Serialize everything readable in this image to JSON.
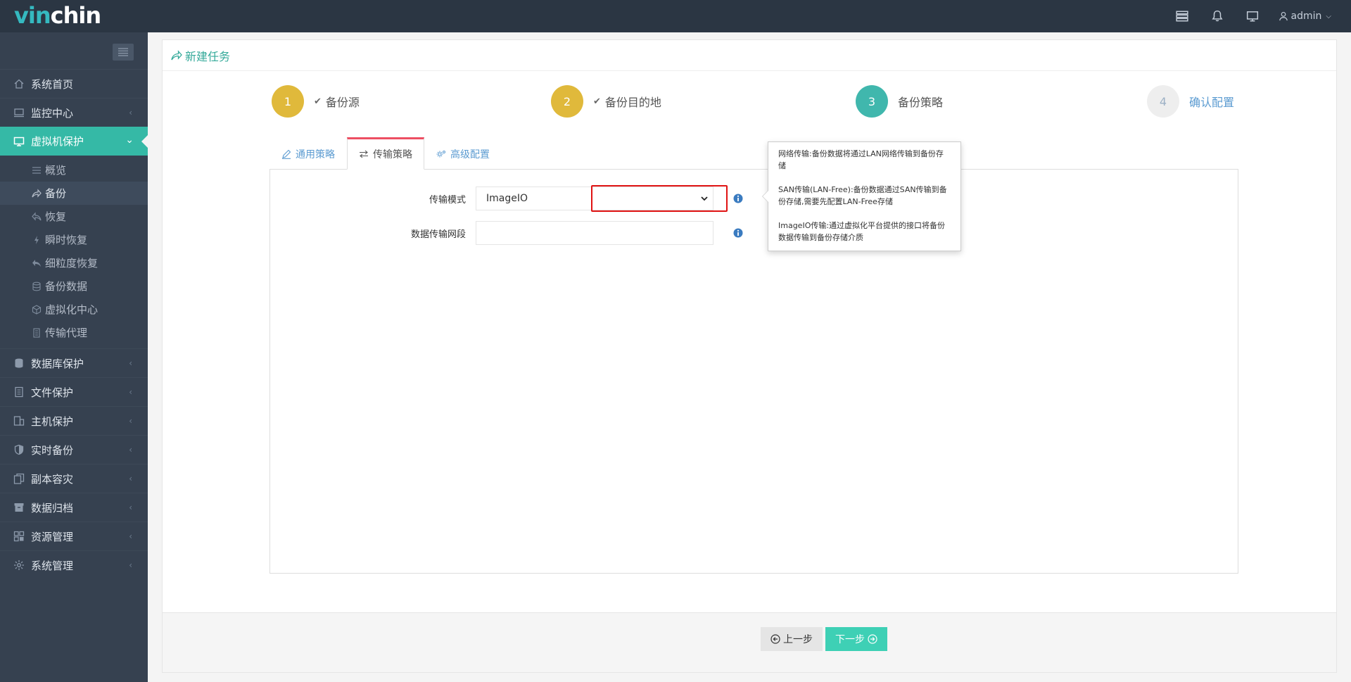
{
  "brand": {
    "part1": "vin",
    "part2": "chin"
  },
  "topbar": {
    "user": "admin"
  },
  "sidebar": {
    "items": [
      {
        "label": "系统首页",
        "icon": "home-icon"
      },
      {
        "label": "监控中心",
        "icon": "monitor-icon"
      },
      {
        "label": "虚拟机保护",
        "icon": "desktop-icon"
      },
      {
        "label": "数据库保护",
        "icon": "database-icon"
      },
      {
        "label": "文件保护",
        "icon": "file-icon"
      },
      {
        "label": "主机保护",
        "icon": "host-icon"
      },
      {
        "label": "实时备份",
        "icon": "shield-icon"
      },
      {
        "label": "副本容灾",
        "icon": "copy-icon"
      },
      {
        "label": "数据归档",
        "icon": "archive-icon"
      },
      {
        "label": "资源管理",
        "icon": "grid-icon"
      },
      {
        "label": "系统管理",
        "icon": "gear-icon"
      }
    ],
    "sub_items": [
      {
        "label": "概览"
      },
      {
        "label": "备份"
      },
      {
        "label": "恢复"
      },
      {
        "label": "瞬时恢复"
      },
      {
        "label": "细粒度恢复"
      },
      {
        "label": "备份数据"
      },
      {
        "label": "虚拟化中心"
      },
      {
        "label": "传输代理"
      }
    ]
  },
  "page": {
    "title": "新建任务"
  },
  "steps": [
    {
      "num": "1",
      "label": "备份源",
      "state": "done"
    },
    {
      "num": "2",
      "label": "备份目的地",
      "state": "done"
    },
    {
      "num": "3",
      "label": "备份策略",
      "state": "current"
    },
    {
      "num": "4",
      "label": "确认配置",
      "state": "todo"
    }
  ],
  "tabs": [
    {
      "label": "通用策略"
    },
    {
      "label": "传输策略"
    },
    {
      "label": "高级配置"
    }
  ],
  "form": {
    "mode_label": "传输模式",
    "mode_value": "ImageIO",
    "segment_label": "数据传输网段",
    "segment_value": ""
  },
  "popover": {
    "line1": "网络传输:备份数据将通过LAN网络传输到备份存储",
    "line2": "SAN传输(LAN-Free):备份数据通过SAN传输到备份存储,需要先配置LAN-Free存储",
    "line3": "ImageIO传输:通过虚拟化平台提供的接口将备份数据传输到备份存储介质"
  },
  "footer": {
    "prev": "上一步",
    "next": "下一步"
  },
  "colors": {
    "accent": "#35b9a6",
    "step_done": "#e0b93b",
    "step_current": "#40b7ad",
    "highlight": "#e01313"
  }
}
